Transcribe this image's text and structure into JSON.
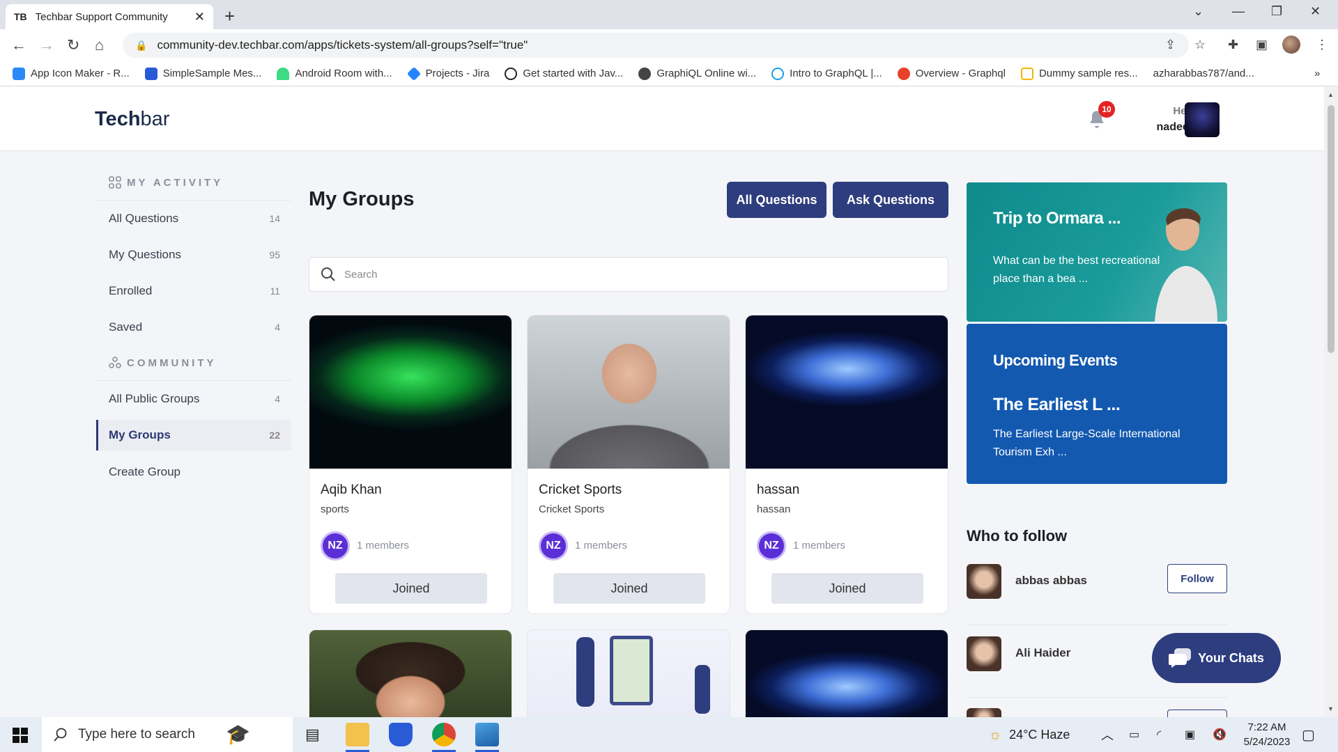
{
  "browser": {
    "tab_favicon": "TB",
    "tab_title": "Techbar Support Community",
    "url": "community-dev.techbar.com/apps/tickets-system/all-groups?self=\"true\"",
    "bookmarks": [
      "App Icon Maker - R...",
      "SimpleSample Mes...",
      "Android Room with...",
      "Projects - Jira",
      "Get started with Jav...",
      "GraphiQL Online wi...",
      "Intro to GraphQL |...",
      "Overview - Graphql",
      "Dummy sample res...",
      "azharabbas787/and..."
    ]
  },
  "header": {
    "logo_bold": "Tech",
    "logo_light": "bar",
    "notification_count": "10",
    "greeting": "Hello",
    "username": "nadeem"
  },
  "sidebar": {
    "activity_title": "MY ACTIVITY",
    "activity_items": [
      {
        "label": "All Questions",
        "count": "14"
      },
      {
        "label": "My Questions",
        "count": "95"
      },
      {
        "label": "Enrolled",
        "count": "11"
      },
      {
        "label": "Saved",
        "count": "4"
      }
    ],
    "community_title": "COMMUNITY",
    "community_items": [
      {
        "label": "All Public Groups",
        "count": "4"
      },
      {
        "label": "My Groups",
        "count": "22"
      },
      {
        "label": "Create Group",
        "count": ""
      }
    ]
  },
  "main": {
    "title": "My Groups",
    "all_questions_btn": "All Questions",
    "ask_questions_btn": "Ask Questions",
    "search_placeholder": "Search",
    "groups": [
      {
        "name": "Aqib Khan",
        "category": "sports",
        "initials": "NZ",
        "members": "1 members",
        "status": "Joined"
      },
      {
        "name": "Cricket Sports",
        "category": "Cricket Sports",
        "initials": "NZ",
        "members": "1 members",
        "status": "Joined"
      },
      {
        "name": "hassan",
        "category": "hassan",
        "initials": "NZ",
        "members": "1 members",
        "status": "Joined"
      }
    ]
  },
  "right": {
    "promo1_title": "Trip to Ormara ...",
    "promo1_desc": "What can be the best recreational place than a bea ...",
    "events_title": "Upcoming Events",
    "event_name": "The Earliest L ...",
    "event_desc": "The Earliest Large-Scale International Tourism Exh ...",
    "who_to_follow": "Who to follow",
    "follow_list": [
      {
        "name": "abbas abbas",
        "button": "Follow"
      },
      {
        "name": "Ali Haider",
        "button": ""
      }
    ],
    "chats_label": "Your Chats"
  },
  "taskbar": {
    "search_placeholder": "Type here to search",
    "weather": "24°C  Haze",
    "time": "7:22 AM",
    "date": "5/24/2023"
  }
}
